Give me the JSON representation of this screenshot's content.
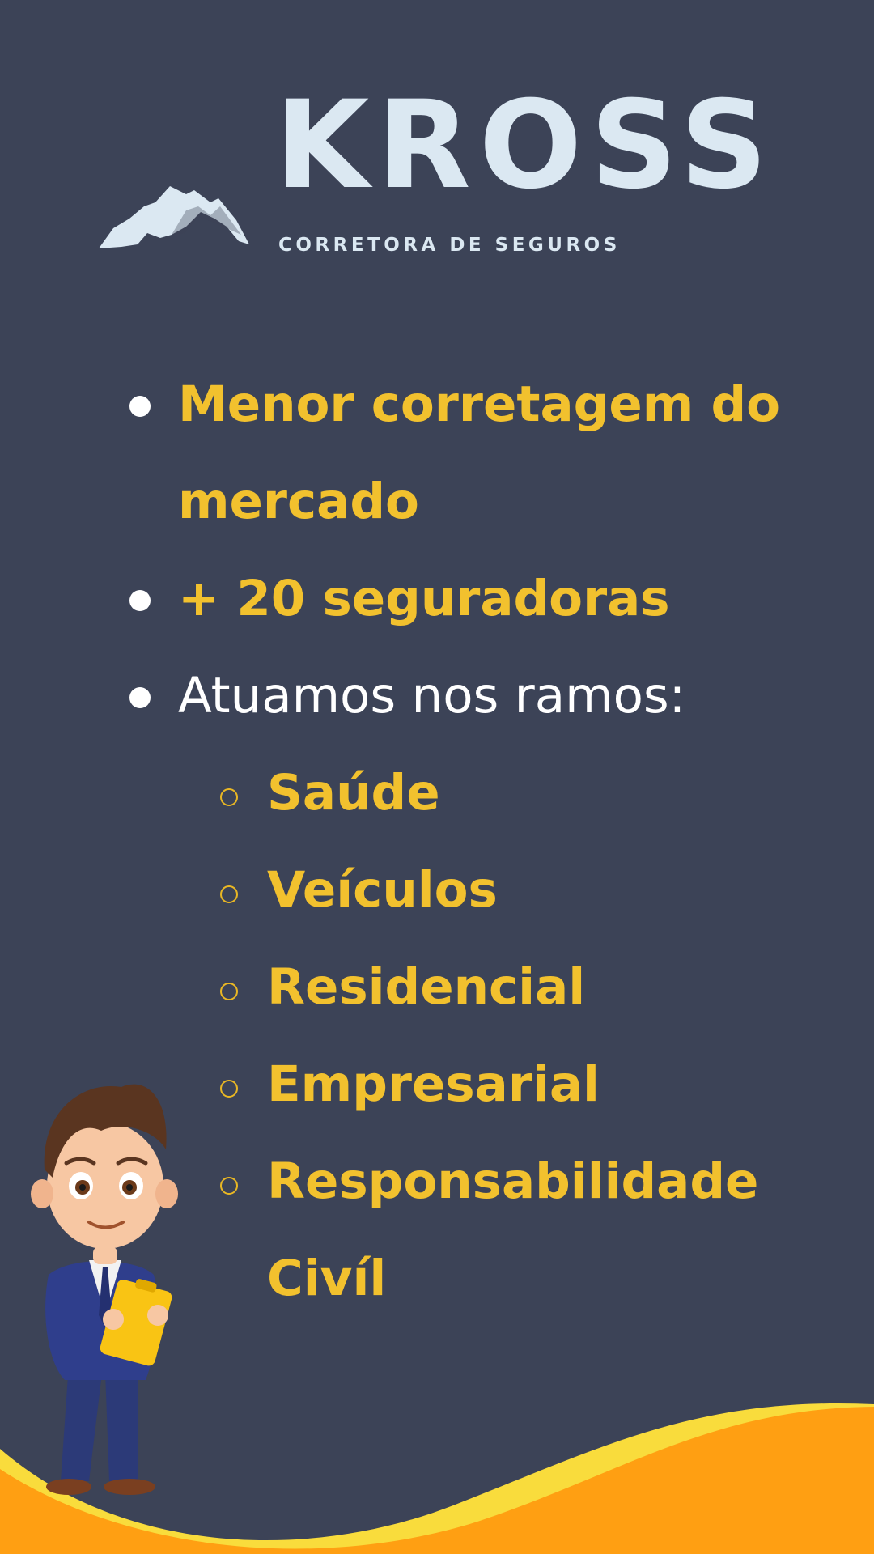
{
  "brand": {
    "name": "KROSS",
    "tagline": "CORRETORA DE SEGUROS",
    "text_color": "#dbe8f2"
  },
  "colors": {
    "background": "#3c4357",
    "highlight": "#f2c12e",
    "wave_light": "#f9dc3c",
    "wave_dark": "#ff9f12"
  },
  "items": [
    {
      "text": "Menor corretagem do mercado"
    },
    {
      "text": "+ 20 seguradoras"
    },
    {
      "text": "Atuamos nos ramos:"
    }
  ],
  "sub_items": [
    {
      "text": "Saúde"
    },
    {
      "text": "Veículos"
    },
    {
      "text": "Residencial"
    },
    {
      "text": "Empresarial"
    },
    {
      "text": "Responsabilidade Civíl"
    }
  ],
  "illustration": {
    "icon": "businessman-character-icon"
  }
}
